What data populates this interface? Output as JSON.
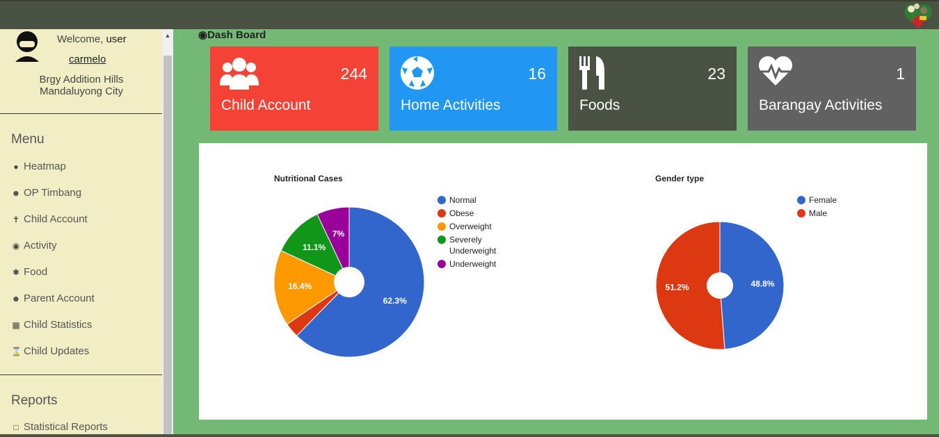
{
  "header": {
    "logo": "app-logo"
  },
  "sidebar": {
    "welcome_prefix": "Welcome,",
    "welcome_name": "user",
    "username": "carmelo",
    "location_line1": "Brgy Addition Hills",
    "location_line2": "Mandaluyong City",
    "menu_title": "Menu",
    "items": [
      {
        "label": "Heatmap",
        "icon": "globe-icon"
      },
      {
        "label": "OP Timbang",
        "icon": "user-circle-icon"
      },
      {
        "label": "Child Account",
        "icon": "child-icon"
      },
      {
        "label": "Activity",
        "icon": "gamepad-icon"
      },
      {
        "label": "Food",
        "icon": "wheat-icon"
      },
      {
        "label": "Parent Account",
        "icon": "user-circle-icon"
      },
      {
        "label": "Child Statistics",
        "icon": "table-icon"
      },
      {
        "label": "Child Updates",
        "icon": "hourglass-icon"
      }
    ],
    "reports_title": "Reports",
    "reports_items": [
      {
        "label": "Statistical Reports",
        "icon": "pdf-file-icon"
      }
    ]
  },
  "main": {
    "title": "Dash Board",
    "cards": [
      {
        "label": "Child Account",
        "count": "244",
        "color": "#f44336",
        "icon": "users-icon"
      },
      {
        "label": "Home Activities",
        "count": "16",
        "color": "#2196f3",
        "icon": "soccer-ball-icon"
      },
      {
        "label": "Foods",
        "count": "23",
        "color": "#4a5343",
        "icon": "utensils-icon"
      },
      {
        "label": "Barangay Activities",
        "count": "1",
        "color": "#616161",
        "icon": "heartbeat-icon"
      }
    ]
  },
  "chart_data": [
    {
      "type": "pie",
      "title": "Nutritional Cases",
      "donut": true,
      "legend": "right",
      "labels": [
        "Normal",
        "Obese",
        "Overweight",
        "Severely Underweight",
        "Underweight"
      ],
      "legend_lines": [
        [
          "Normal"
        ],
        [
          "Obese"
        ],
        [
          "Overweight"
        ],
        [
          "Severely",
          "Underweight"
        ],
        [
          "Underweight"
        ]
      ],
      "values": [
        62.3,
        3.2,
        16.4,
        11.1,
        7.0
      ],
      "display": [
        "62.3%",
        "",
        "16.4%",
        "11.1%",
        "7%"
      ],
      "colors": [
        "#3366cc",
        "#dc3912",
        "#ff9900",
        "#109618",
        "#990099"
      ]
    },
    {
      "type": "pie",
      "title": "Gender type",
      "donut": true,
      "legend": "right",
      "labels": [
        "Female",
        "Male"
      ],
      "legend_lines": [
        [
          "Female"
        ],
        [
          "Male"
        ]
      ],
      "values": [
        48.8,
        51.2
      ],
      "display": [
        "48.8%",
        "51.2%"
      ],
      "colors": [
        "#3366cc",
        "#dc3912"
      ]
    }
  ]
}
